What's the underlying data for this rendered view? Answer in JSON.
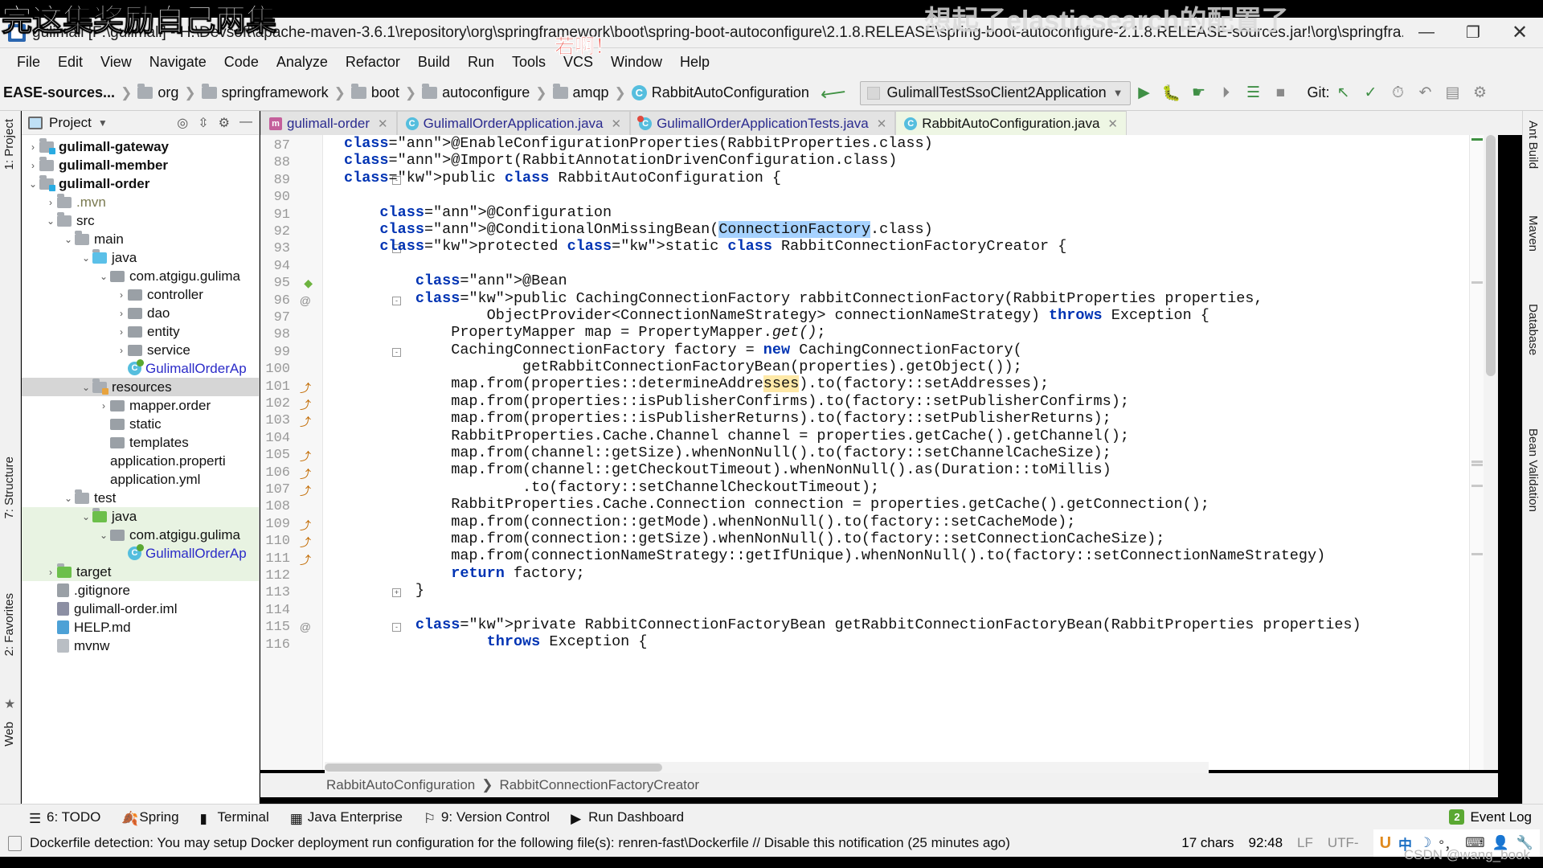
{
  "watermarks": {
    "top_left": "完这集奖励自己两集",
    "top_right": "想起了elasticsearch的配置了",
    "red": "若啊！",
    "csdn": "CSDN @wang_book"
  },
  "titlebar": {
    "title": "gulimall [F:\\gulimall] - H:\\Devsoft\\apache-maven-3.6.1\\repository\\org\\springframework\\boot\\spring-boot-autoconfigure\\2.1.8.RELEASE\\spring-boot-autoconfigure-2.1.8.RELEASE-sources.jar!\\org\\springfra...",
    "minimize": "—",
    "maximize": "❐",
    "close": "✕"
  },
  "menubar": {
    "items": [
      "File",
      "Edit",
      "View",
      "Navigate",
      "Code",
      "Analyze",
      "Refactor",
      "Build",
      "Run",
      "Tools",
      "VCS",
      "Window",
      "Help"
    ]
  },
  "navbar": {
    "breadcrumb": [
      {
        "label": "EASE-sources...",
        "icon": "none"
      },
      {
        "label": "org",
        "icon": "folder-icon"
      },
      {
        "label": "springframework",
        "icon": "folder-icon"
      },
      {
        "label": "boot",
        "icon": "folder-icon"
      },
      {
        "label": "autoconfigure",
        "icon": "folder-icon"
      },
      {
        "label": "amqp",
        "icon": "folder-icon"
      },
      {
        "label": "RabbitAutoConfiguration",
        "icon": "class-icon"
      }
    ],
    "run_config": "GulimallTestSsoClient2Application",
    "git_label": "Git:",
    "icons": [
      "run-icon",
      "debug-icon",
      "run-with-coverage-icon",
      "profile-icon",
      "attach-icon",
      "stop-icon",
      "git-update-icon",
      "git-commit-icon",
      "git-history-icon",
      "git-rollback-icon",
      "search-everywhere-icon",
      "settings-icon"
    ]
  },
  "tabs": [
    {
      "label": "gulimall-order",
      "icon": "maven-icon",
      "active": false
    },
    {
      "label": "GulimallOrderApplication.java",
      "icon": "class-icon",
      "active": false
    },
    {
      "label": "GulimallOrderApplicationTests.java",
      "icon": "test-class-icon",
      "active": false
    },
    {
      "label": "RabbitAutoConfiguration.java",
      "icon": "class-icon",
      "active": true
    }
  ],
  "left_stripe": [
    "1: Project",
    "7: Structure",
    "2: Favorites",
    "Web"
  ],
  "right_stripe": [
    "Ant Build",
    "Maven",
    "Database",
    "Bean Validation"
  ],
  "project_panel": {
    "title": "Project",
    "tree": [
      {
        "depth": 1,
        "arrow": "›",
        "icon": "module-folder-icon",
        "label": "gulimall-gateway",
        "bold": true
      },
      {
        "depth": 1,
        "arrow": "›",
        "icon": "module-folder-icon",
        "label": "gulimall-member",
        "bold": true
      },
      {
        "depth": 1,
        "arrow": "⌄",
        "icon": "module-folder-icon",
        "label": "gulimall-order",
        "bold": true
      },
      {
        "depth": 2,
        "arrow": "›",
        "icon": "folder-icon",
        "label": ".mvn",
        "dim": true
      },
      {
        "depth": 2,
        "arrow": "⌄",
        "icon": "folder-icon",
        "label": "src"
      },
      {
        "depth": 3,
        "arrow": "⌄",
        "icon": "folder-icon",
        "label": "main"
      },
      {
        "depth": 4,
        "arrow": "⌄",
        "icon": "source-folder-icon",
        "label": "java"
      },
      {
        "depth": 5,
        "arrow": "⌄",
        "icon": "package-icon",
        "label": "com.atgigu.gulima"
      },
      {
        "depth": 6,
        "arrow": "›",
        "icon": "package-icon",
        "label": "controller"
      },
      {
        "depth": 6,
        "arrow": "›",
        "icon": "package-icon",
        "label": "dao"
      },
      {
        "depth": 6,
        "arrow": "›",
        "icon": "package-icon",
        "label": "entity"
      },
      {
        "depth": 6,
        "arrow": "›",
        "icon": "package-icon",
        "label": "service"
      },
      {
        "depth": 6,
        "arrow": "",
        "icon": "runnable-class-icon",
        "label": "GulimallOrderAp",
        "link": true
      },
      {
        "depth": 4,
        "arrow": "⌄",
        "icon": "resources-folder-icon",
        "label": "resources",
        "selected": true
      },
      {
        "depth": 5,
        "arrow": "›",
        "icon": "package-icon",
        "label": "mapper.order"
      },
      {
        "depth": 5,
        "arrow": "",
        "icon": "package-icon",
        "label": "static"
      },
      {
        "depth": 5,
        "arrow": "",
        "icon": "package-icon",
        "label": "templates"
      },
      {
        "depth": 5,
        "arrow": "",
        "icon": "yml-icon",
        "label": "application.properti"
      },
      {
        "depth": 5,
        "arrow": "",
        "icon": "yml-icon",
        "label": "application.yml"
      },
      {
        "depth": 3,
        "arrow": "⌄",
        "icon": "folder-icon",
        "label": "test"
      },
      {
        "depth": 4,
        "arrow": "⌄",
        "icon": "test-source-folder-icon",
        "label": "java",
        "green": true
      },
      {
        "depth": 5,
        "arrow": "⌄",
        "icon": "package-icon",
        "label": "com.atgigu.gulima",
        "green": true
      },
      {
        "depth": 6,
        "arrow": "",
        "icon": "runnable-class-icon",
        "label": "GulimallOrderAp",
        "link": true,
        "green": true
      },
      {
        "depth": 2,
        "arrow": "›",
        "icon": "target-folder-icon",
        "label": "target",
        "green": true
      },
      {
        "depth": 2,
        "arrow": "",
        "icon": "gitignore-icon",
        "label": ".gitignore"
      },
      {
        "depth": 2,
        "arrow": "",
        "icon": "iml-icon",
        "label": "gulimall-order.iml"
      },
      {
        "depth": 2,
        "arrow": "",
        "icon": "md-icon",
        "label": "HELP.md"
      },
      {
        "depth": 2,
        "arrow": "",
        "icon": "file-icon",
        "label": "mvnw"
      }
    ]
  },
  "editor": {
    "first_line": 87,
    "lines": [
      {
        "n": 87,
        "mark": "",
        "text": "@EnableConfigurationProperties(RabbitProperties.class)"
      },
      {
        "n": 88,
        "mark": "",
        "text": "@Import(RabbitAnnotationDrivenConfiguration.class)"
      },
      {
        "n": 89,
        "mark": "",
        "text": "public class RabbitAutoConfiguration {"
      },
      {
        "n": 90,
        "mark": "",
        "text": ""
      },
      {
        "n": 91,
        "mark": "",
        "text": "    @Configuration"
      },
      {
        "n": 92,
        "mark": "",
        "text": "    @ConditionalOnMissingBean(ConnectionFactory.class)"
      },
      {
        "n": 93,
        "mark": "",
        "text": "    protected static class RabbitConnectionFactoryCreator {"
      },
      {
        "n": 94,
        "mark": "",
        "text": ""
      },
      {
        "n": 95,
        "mark": "bean",
        "text": "        @Bean"
      },
      {
        "n": 96,
        "mark": "@",
        "text": "        public CachingConnectionFactory rabbitConnectionFactory(RabbitProperties properties,"
      },
      {
        "n": 97,
        "mark": "",
        "text": "                ObjectProvider<ConnectionNameStrategy> connectionNameStrategy) throws Exception {"
      },
      {
        "n": 98,
        "mark": "",
        "text": "            PropertyMapper map = PropertyMapper.get();"
      },
      {
        "n": 99,
        "mark": "",
        "text": "            CachingConnectionFactory factory = new CachingConnectionFactory("
      },
      {
        "n": 100,
        "mark": "",
        "text": "                    getRabbitConnectionFactoryBean(properties).getObject());"
      },
      {
        "n": 101,
        "mark": "arrow",
        "text": "            map.from(properties::determineAddresses).to(factory::setAddresses);"
      },
      {
        "n": 102,
        "mark": "arrow",
        "text": "            map.from(properties::isPublisherConfirms).to(factory::setPublisherConfirms);"
      },
      {
        "n": 103,
        "mark": "arrow",
        "text": "            map.from(properties::isPublisherReturns).to(factory::setPublisherReturns);"
      },
      {
        "n": 104,
        "mark": "",
        "text": "            RabbitProperties.Cache.Channel channel = properties.getCache().getChannel();"
      },
      {
        "n": 105,
        "mark": "arrow",
        "text": "            map.from(channel::getSize).whenNonNull().to(factory::setChannelCacheSize);"
      },
      {
        "n": 106,
        "mark": "arrow",
        "text": "            map.from(channel::getCheckoutTimeout).whenNonNull().as(Duration::toMillis)"
      },
      {
        "n": 107,
        "mark": "arrow",
        "text": "                    .to(factory::setChannelCheckoutTimeout);"
      },
      {
        "n": 108,
        "mark": "",
        "text": "            RabbitProperties.Cache.Connection connection = properties.getCache().getConnection();"
      },
      {
        "n": 109,
        "mark": "arrow",
        "text": "            map.from(connection::getMode).whenNonNull().to(factory::setCacheMode);"
      },
      {
        "n": 110,
        "mark": "arrow",
        "text": "            map.from(connection::getSize).whenNonNull().to(factory::setConnectionCacheSize);"
      },
      {
        "n": 111,
        "mark": "arrow",
        "text": "            map.from(connectionNameStrategy::getIfUnique).whenNonNull().to(factory::setConnectionNameStrategy)"
      },
      {
        "n": 112,
        "mark": "",
        "text": "            return factory;"
      },
      {
        "n": 113,
        "mark": "",
        "text": "        }"
      },
      {
        "n": 114,
        "mark": "",
        "text": ""
      },
      {
        "n": 115,
        "mark": "@",
        "text": "        private RabbitConnectionFactoryBean getRabbitConnectionFactoryBean(RabbitProperties properties)"
      },
      {
        "n": 116,
        "mark": "",
        "text": "                throws Exception {"
      }
    ],
    "selected_token": "ConnectionFactory",
    "breadcrumb": [
      "RabbitAutoConfiguration",
      "RabbitConnectionFactoryCreator"
    ]
  },
  "bottom_toolbar": {
    "items": [
      {
        "label": "6: TODO",
        "icon": "todo-icon"
      },
      {
        "label": "Spring",
        "icon": "spring-leaf-icon"
      },
      {
        "label": "Terminal",
        "icon": "terminal-icon"
      },
      {
        "label": "Java Enterprise",
        "icon": "java-ee-icon"
      },
      {
        "label": "9: Version Control",
        "icon": "vcs-icon"
      },
      {
        "label": "Run Dashboard",
        "icon": "run-dashboard-icon"
      }
    ],
    "event_log": "Event Log",
    "event_count": "2"
  },
  "statusbar": {
    "message": "Dockerfile detection: You may setup Docker deployment run configuration for the following file(s): renren-fast\\Dockerfile // Disable this notification (25 minutes ago)",
    "chars": "17 chars",
    "caret": "92:48",
    "line_sep": "LF",
    "encoding": "UTF-",
    "tray": [
      "U",
      "中",
      "☽",
      "°，",
      "keyboard-icon",
      "user-icon",
      "wrench-icon"
    ]
  }
}
